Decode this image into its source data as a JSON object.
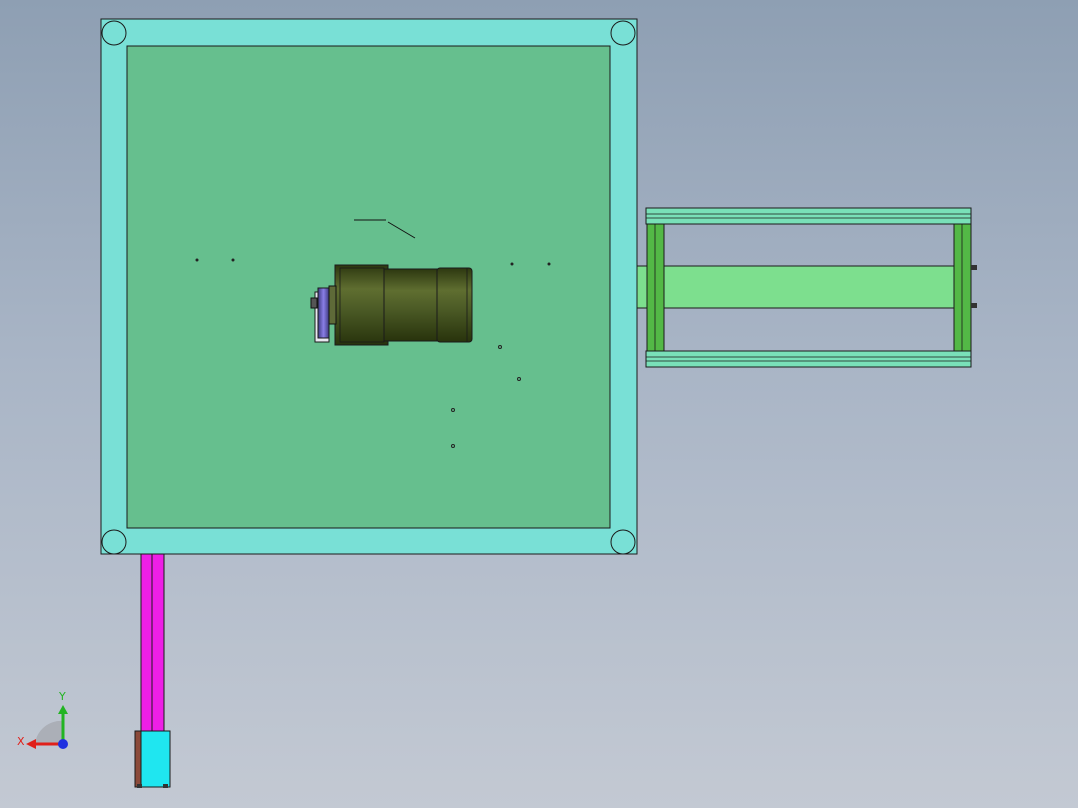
{
  "viewport": {
    "background_top": "#8e9fb3",
    "background_bottom": "#c3c9d3"
  },
  "colors": {
    "frame": "#79e0d6",
    "plate": "#66bf8e",
    "rail_frame": "#79e0b8",
    "rail_bar": "#7ddf8e",
    "rail_side": "#53b846",
    "magenta_bar": "#ee1fe6",
    "cyan_block": "#1fe6f0",
    "motor": "#4b5a28",
    "wheel": "#7c72d8",
    "axis_x": "#e0201a",
    "axis_y": "#22b422",
    "axis_z": "#2030e0"
  },
  "triad": {
    "x_label": "X",
    "y_label": "Y"
  }
}
